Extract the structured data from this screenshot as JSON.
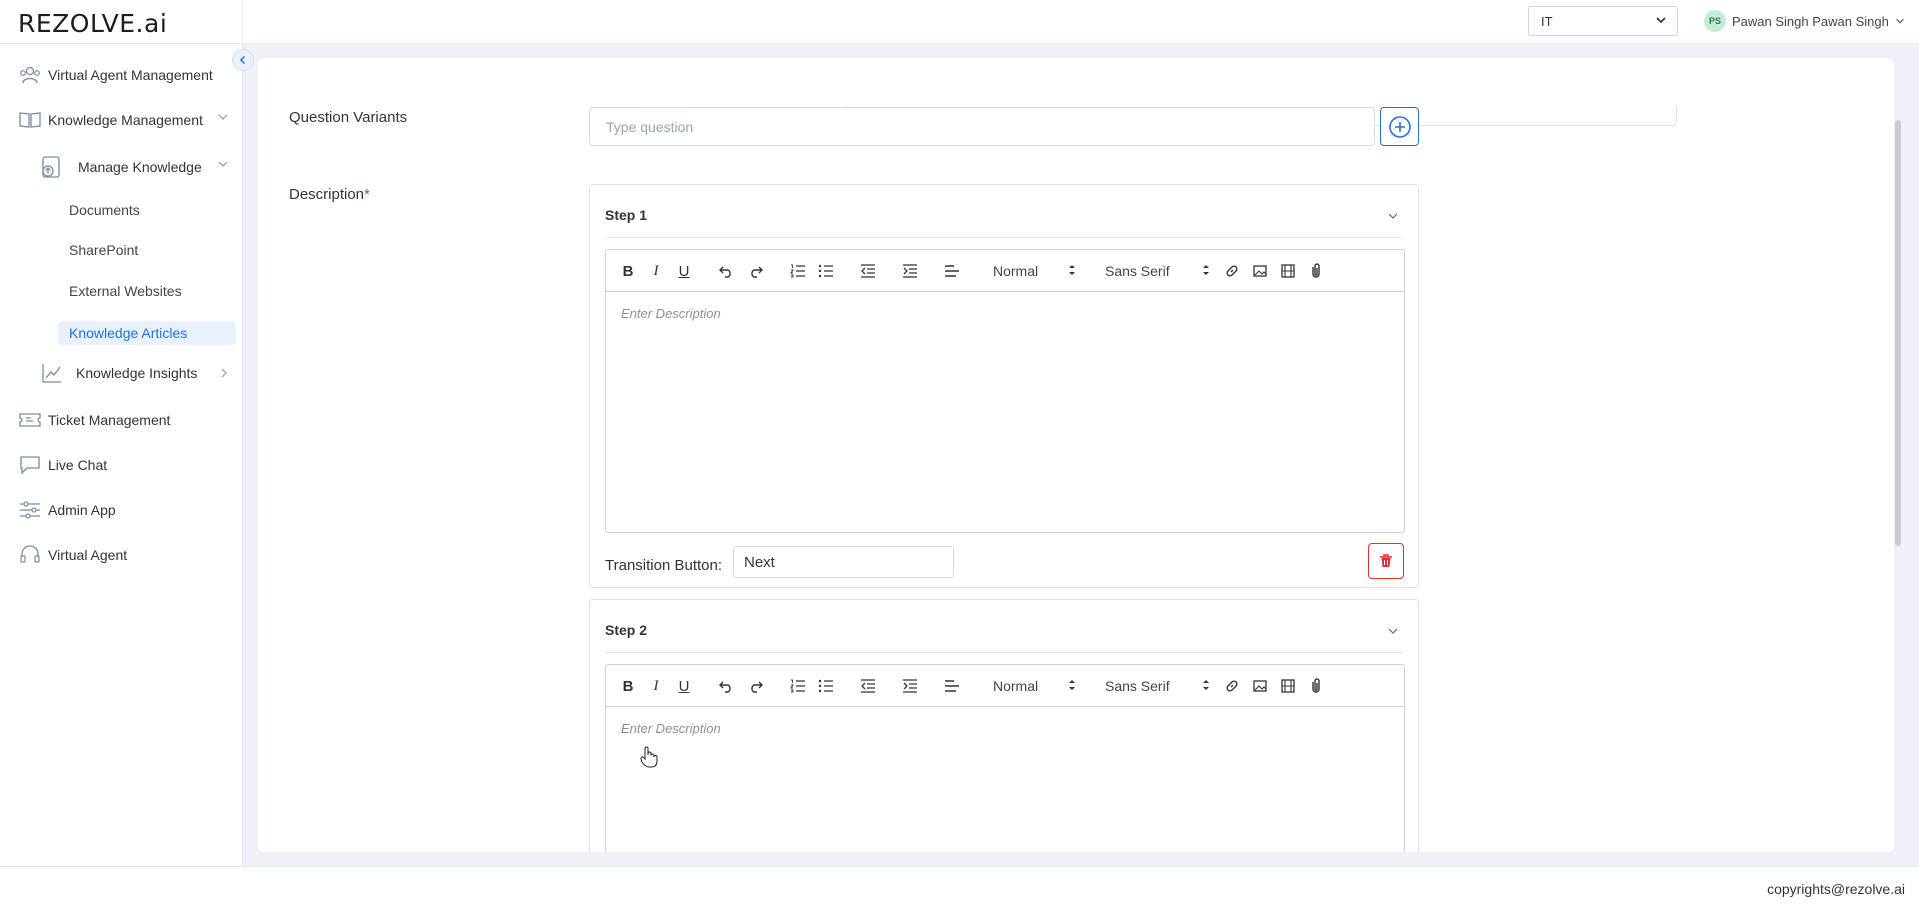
{
  "header": {
    "logo": "REZOLVE.ai",
    "tenant": "IT",
    "user_initials": "PS",
    "user_name": "Pawan Singh Pawan Singh"
  },
  "sidebar": {
    "items": [
      {
        "label": "Virtual Agent Management",
        "icon": "users-icon"
      },
      {
        "label": "Knowledge Management",
        "icon": "book-icon"
      },
      {
        "label": "Manage Knowledge",
        "icon": "knowledge-upload-icon"
      },
      {
        "label": "Knowledge Insights",
        "icon": "chart-icon"
      },
      {
        "label": "Ticket Management",
        "icon": "ticket-icon"
      },
      {
        "label": "Live Chat",
        "icon": "chat-icon"
      },
      {
        "label": "Admin App",
        "icon": "sliders-icon"
      },
      {
        "label": "Virtual Agent",
        "icon": "headset-icon"
      }
    ],
    "sub_items": [
      "Documents",
      "SharePoint",
      "External Websites",
      "Knowledge Articles"
    ],
    "active": "Knowledge Articles"
  },
  "form": {
    "question_label": "Question Variants",
    "question_placeholder": "Type question",
    "description_label": "Description",
    "required_mark": "*"
  },
  "steps": [
    {
      "title": "Step 1",
      "format": "Normal",
      "font": "Sans Serif",
      "placeholder": "Enter Description",
      "transition_label": "Transition Button:",
      "transition_value": "Next"
    },
    {
      "title": "Step 2",
      "format": "Normal",
      "font": "Sans Serif",
      "placeholder": "Enter Description"
    }
  ],
  "footer": {
    "copyright": "copyrights@rezolve.ai"
  },
  "colors": {
    "accent": "#1f72d1",
    "danger": "#e03131",
    "background": "#eef2f8"
  }
}
